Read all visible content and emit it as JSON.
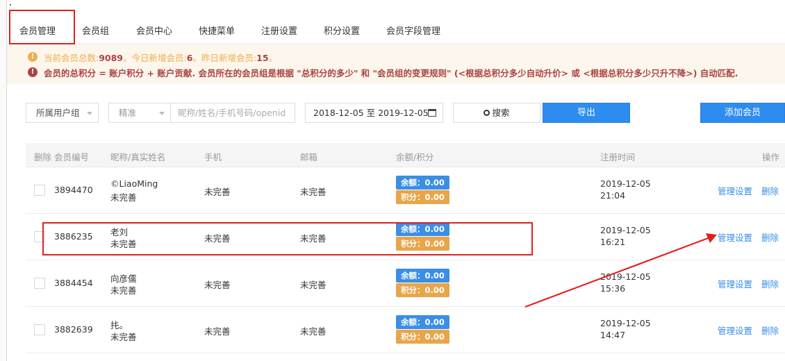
{
  "tabs": [
    "会员管理",
    "会员组",
    "会员中心",
    "快捷菜单",
    "注册设置",
    "积分设置",
    "会员字段管理"
  ],
  "notice": {
    "stats_prefix": "当前会员总数:",
    "total_members": "9089",
    "today_label": "。今日新增会员:",
    "today_new": "6",
    "yesterday_label": "。昨日新增会员:",
    "yesterday_new": "15",
    "stats_suffix": "。",
    "rule_text": "会员的总积分 = 账户积分 + 账户贡献. 会员所在的会员组是根据 \"总积分的多少\" 和 \"会员组的变更规则\" (<根据总积分多少自动升价> 或 <根据总积分多少只升不降>) 自动匹配."
  },
  "filters": {
    "group_select": "所属用户组",
    "match_select": "精准",
    "search_placeholder": "昵称/姓名/手机号码/openid",
    "date_range": "2018-12-05 至 2019-12-05",
    "search_button": "搜索",
    "export_button": "导出",
    "add_button": "添加会员"
  },
  "table": {
    "headers": {
      "delete": "删除",
      "member_id": "会员编号",
      "name": "昵称/真实姓名",
      "phone": "手机",
      "email": "邮箱",
      "balance": "余额/积分",
      "reg_time": "注册时间",
      "actions": "操作"
    },
    "rows": [
      {
        "id": "3894470",
        "nickname": "©LiaoMing",
        "realname": "未完善",
        "phone": "未完善",
        "email": "未完善",
        "balance": "余额：0.00",
        "points": "积分：0.00",
        "date": "2019-12-05",
        "time": "21:04",
        "manage": "管理设置",
        "delete": "删除"
      },
      {
        "id": "3886235",
        "nickname": "老刘",
        "realname": "未完善",
        "phone": "未完善",
        "email": "未完善",
        "balance": "余额：0.00",
        "points": "积分：0.00",
        "date": "2019-12-05",
        "time": "16:21",
        "manage": "管理设置",
        "delete": "删除"
      },
      {
        "id": "3884454",
        "nickname": "向彦儒",
        "realname": "未完善",
        "phone": "未完善",
        "email": "未完善",
        "balance": "余额：0.00",
        "points": "积分：0.00",
        "date": "2019-12-05",
        "time": "15:36",
        "manage": "管理设置",
        "delete": "删除"
      },
      {
        "id": "3882639",
        "nickname": "扥。",
        "realname": "未完善",
        "phone": "未完善",
        "email": "未完善",
        "balance": "余额：0.00",
        "points": "积分：0.00",
        "date": "2019-12-05",
        "time": "14:47",
        "manage": "管理设置",
        "delete": "删除"
      }
    ]
  },
  "colors": {
    "accent": "#2d8cf0",
    "annotation": "#e02020",
    "points_badge": "#e8a54a",
    "balance_badge": "#3a8ee6"
  }
}
